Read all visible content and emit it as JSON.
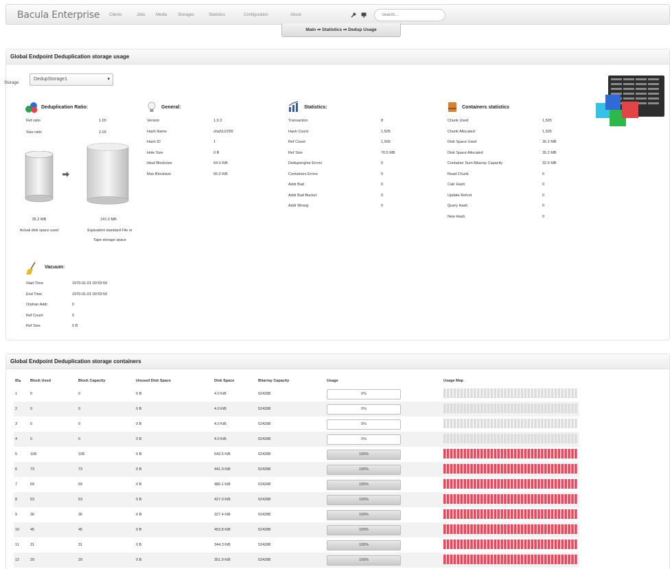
{
  "nav": {
    "brand": "Bacula Enterprise",
    "items": [
      "Clients",
      "Jobs",
      "Media",
      "Storages",
      "Statistics",
      "Configuration",
      "About"
    ],
    "search_placeholder": "Search..."
  },
  "breadcrumb": "Main ⇒ Statistics ⇒ Dedup Usage",
  "usage_panel": {
    "title": "Global Endpoint Deduplication storage usage",
    "storage_label": "Storage:",
    "storage_value": "DedupStorage1",
    "dedup_ratio": {
      "title": "Deduplication Ratio:",
      "rows": [
        {
          "k": "Ref ratio",
          "v": "1.03"
        },
        {
          "k": "Size ratio",
          "v": "2.03"
        }
      ],
      "actual_size": "35.2 MB",
      "actual_label": "Actual disk space used",
      "equiv_size": "141.0 MB",
      "equiv_label_1": "Equivalent standard File or",
      "equiv_label_2": "Tape storage space"
    },
    "general": {
      "title": "General:",
      "rows": [
        {
          "k": "Version",
          "v": "1.0.3"
        },
        {
          "k": "Hash Name",
          "v": "sha512/256"
        },
        {
          "k": "Hash ID",
          "v": "1"
        },
        {
          "k": "Hole Size",
          "v": "0 B"
        },
        {
          "k": "Ideal Blocksize",
          "v": "64.0 KiB"
        },
        {
          "k": "Max Blocksize",
          "v": "65.0 KiB"
        }
      ]
    },
    "statistics": {
      "title": "Statistics:",
      "rows": [
        {
          "k": "Transaction",
          "v": "8"
        },
        {
          "k": "Hash Count",
          "v": "1,505"
        },
        {
          "k": "Ref Count",
          "v": "1,506"
        },
        {
          "k": "Ref Size",
          "v": "70.5 MB"
        },
        {
          "k": "Dedupengine Errors",
          "v": "0"
        },
        {
          "k": "Containers Errors",
          "v": "0"
        },
        {
          "k": "Addr Bad",
          "v": "0"
        },
        {
          "k": "Addr Bad Bucket",
          "v": "0"
        },
        {
          "k": "Addr Wrong",
          "v": "0"
        }
      ]
    },
    "containers": {
      "title": "Containers statistics",
      "rows": [
        {
          "k": "Chunk Used",
          "v": "1,505"
        },
        {
          "k": "Chunk Allocated",
          "v": "1,505"
        },
        {
          "k": "Disk Space Used",
          "v": "35.2 MB"
        },
        {
          "k": "Disk Space Allocated",
          "v": "35.2 MB"
        },
        {
          "k": "Container Sum Bitarray Capacity",
          "v": "32.5 MB"
        },
        {
          "k": "Read Chunk",
          "v": "0"
        },
        {
          "k": "Calc Hash",
          "v": "0"
        },
        {
          "k": "Update Refcnt",
          "v": "0"
        },
        {
          "k": "Query Hash",
          "v": "0"
        },
        {
          "k": "New Hash",
          "v": "0"
        }
      ]
    },
    "vacuum": {
      "title": "Vacuum:",
      "rows": [
        {
          "k": "Start Time",
          "v": "1970-01-01 00:59:59"
        },
        {
          "k": "End Time",
          "v": "1970-01-01 00:59:59"
        },
        {
          "k": "Orphan Addr",
          "v": "0"
        },
        {
          "k": "Ref Count",
          "v": "0"
        },
        {
          "k": "Ref Size",
          "v": "0 B"
        }
      ]
    }
  },
  "containers_panel": {
    "title": "Global Endpoint Deduplication storage containers",
    "headers": [
      "ID▴",
      "Block Used",
      "Block Capacity",
      "Unused Disk Space",
      "Disk Space",
      "Bitarray Capacity",
      "Usage",
      "Usage Map"
    ],
    "rows": [
      {
        "id": "1",
        "used": "0",
        "cap": "0",
        "unused": "0 B",
        "disk": "4.0 KiB",
        "bitarray": "524288",
        "usage": "0%",
        "fill": 0
      },
      {
        "id": "2",
        "used": "0",
        "cap": "0",
        "unused": "0 B",
        "disk": "4.0 KiB",
        "bitarray": "524288",
        "usage": "0%",
        "fill": 0
      },
      {
        "id": "3",
        "used": "0",
        "cap": "0",
        "unused": "0 B",
        "disk": "4.0 KiB",
        "bitarray": "524288",
        "usage": "0%",
        "fill": 0
      },
      {
        "id": "4",
        "used": "0",
        "cap": "0",
        "unused": "0 B",
        "disk": "4.0 KiB",
        "bitarray": "524288",
        "usage": "0%",
        "fill": 0
      },
      {
        "id": "5",
        "used": "108",
        "cap": "108",
        "unused": "0 B",
        "disk": "543.5 KiB",
        "bitarray": "524288",
        "usage": "100%",
        "fill": 1
      },
      {
        "id": "6",
        "used": "73",
        "cap": "73",
        "unused": "0 B",
        "disk": "441.9 KiB",
        "bitarray": "524288",
        "usage": "100%",
        "fill": 1
      },
      {
        "id": "7",
        "used": "69",
        "cap": "69",
        "unused": "0 B",
        "disk": "486.1 KiB",
        "bitarray": "524288",
        "usage": "100%",
        "fill": 1
      },
      {
        "id": "8",
        "used": "53",
        "cap": "53",
        "unused": "0 B",
        "disk": "427.0 KiB",
        "bitarray": "524288",
        "usage": "100%",
        "fill": 1
      },
      {
        "id": "9",
        "used": "36",
        "cap": "36",
        "unused": "0 B",
        "disk": "327.4 KiB",
        "bitarray": "524288",
        "usage": "100%",
        "fill": 1
      },
      {
        "id": "10",
        "used": "45",
        "cap": "45",
        "unused": "0 B",
        "disk": "453.8 KiB",
        "bitarray": "524288",
        "usage": "100%",
        "fill": 1
      },
      {
        "id": "11",
        "used": "31",
        "cap": "31",
        "unused": "0 B",
        "disk": "344.3 KiB",
        "bitarray": "524288",
        "usage": "100%",
        "fill": 1
      },
      {
        "id": "12",
        "used": "29",
        "cap": "29",
        "unused": "0 B",
        "disk": "351.9 KiB",
        "bitarray": "524288",
        "usage": "100%",
        "fill": 1
      }
    ]
  },
  "colors": {
    "map_full": "#f0445a",
    "map_empty": "#dcdcdc"
  }
}
